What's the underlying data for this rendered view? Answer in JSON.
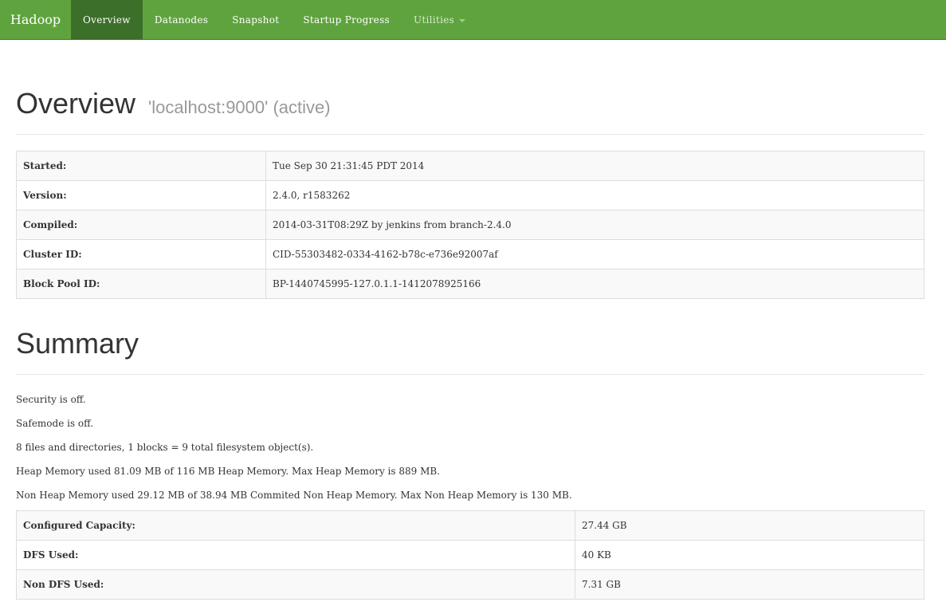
{
  "navbar": {
    "brand": "Hadoop",
    "items": [
      {
        "label": "Overview",
        "active": true
      },
      {
        "label": "Datanodes"
      },
      {
        "label": "Snapshot"
      },
      {
        "label": "Startup Progress"
      },
      {
        "label": "Utilities",
        "dropdown": true
      }
    ]
  },
  "overview": {
    "title": "Overview",
    "subtitle": "'localhost:9000' (active)",
    "rows": [
      {
        "label": "Started:",
        "value": "Tue Sep 30 21:31:45 PDT 2014"
      },
      {
        "label": "Version:",
        "value": "2.4.0, r1583262"
      },
      {
        "label": "Compiled:",
        "value": "2014-03-31T08:29Z by jenkins from branch-2.4.0"
      },
      {
        "label": "Cluster ID:",
        "value": "CID-55303482-0334-4162-b78c-e736e92007af"
      },
      {
        "label": "Block Pool ID:",
        "value": "BP-1440745995-127.0.1.1-1412078925166"
      }
    ]
  },
  "summary": {
    "title": "Summary",
    "lines": [
      "Security is off.",
      "Safemode is off.",
      "8 files and directories, 1 blocks = 9 total filesystem object(s).",
      "Heap Memory used 81.09 MB of 116 MB Heap Memory. Max Heap Memory is 889 MB.",
      "Non Heap Memory used 29.12 MB of 38.94 MB Commited Non Heap Memory. Max Non Heap Memory is 130 MB."
    ],
    "rows": [
      {
        "label": "Configured Capacity:",
        "value": "27.44 GB"
      },
      {
        "label": "DFS Used:",
        "value": "40 KB"
      },
      {
        "label": "Non DFS Used:",
        "value": "7.31 GB"
      }
    ]
  },
  "colors": {
    "navbar": "#5fa33e",
    "active_tab": "#3c6f2a"
  }
}
